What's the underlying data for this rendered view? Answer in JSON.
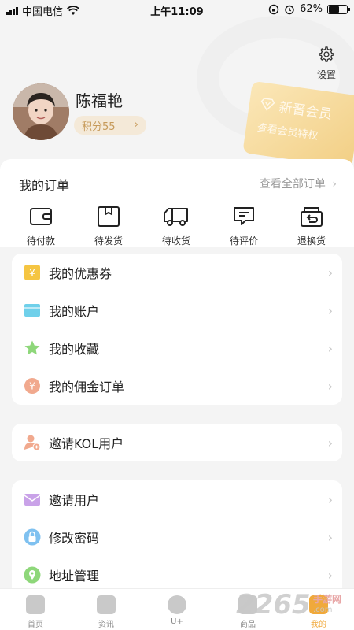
{
  "status_bar": {
    "carrier": "中国电信",
    "time": "上午11:09",
    "battery": "62%",
    "battery_level": 0.62
  },
  "header": {
    "settings_label": "设置",
    "user_name": "陈福艳",
    "points": "积分55",
    "member_title": "新晋会员",
    "member_subtitle": "查看会员特权"
  },
  "orders": {
    "title": "我的订单",
    "view_all": "查看全部订单",
    "items": [
      {
        "label": "待付款",
        "icon": "wallet-icon"
      },
      {
        "label": "待发货",
        "icon": "box-icon"
      },
      {
        "label": "待收货",
        "icon": "truck-icon"
      },
      {
        "label": "待评价",
        "icon": "comment-icon"
      },
      {
        "label": "退换货",
        "icon": "return-icon"
      }
    ]
  },
  "menu_group_1": [
    {
      "label": "我的优惠券",
      "icon": "coupon-icon",
      "color": "#f5c542"
    },
    {
      "label": "我的账户",
      "icon": "card-icon",
      "color": "#6fd0ea"
    },
    {
      "label": "我的收藏",
      "icon": "star-icon",
      "color": "#8ed77a"
    },
    {
      "label": "我的佣金订单",
      "icon": "commission-icon",
      "color": "#f1a98e"
    }
  ],
  "menu_group_2": [
    {
      "label": "邀请KOL用户",
      "icon": "add-user-icon",
      "color": "#f1a98e"
    }
  ],
  "menu_group_3": [
    {
      "label": "邀请用户",
      "icon": "envelope-icon",
      "color": "#c9a2e8"
    },
    {
      "label": "修改密码",
      "icon": "lock-icon",
      "color": "#7fc1f0"
    },
    {
      "label": "地址管理",
      "icon": "location-icon",
      "color": "#8ed77a"
    }
  ],
  "bottom_nav": [
    {
      "label": "首页",
      "icon": "home-icon"
    },
    {
      "label": "资讯",
      "icon": "news-icon"
    },
    {
      "label": "U+",
      "icon": "robot-icon"
    },
    {
      "label": "商品",
      "icon": "goods-icon"
    },
    {
      "label": "我的",
      "icon": "profile-icon"
    }
  ],
  "watermark": {
    "text": "2265",
    "sub": "手游网",
    "url": ".com"
  }
}
